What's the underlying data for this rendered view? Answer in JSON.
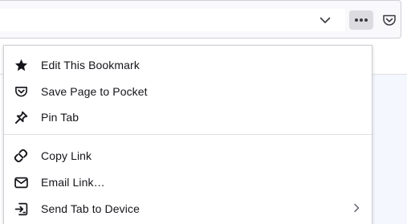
{
  "toolbar": {
    "dropmarker_icon": "chevron-down-icon",
    "page_actions_icon": "more-horizontal-icon",
    "pocket_icon": "pocket-icon"
  },
  "menu": {
    "items": [
      {
        "label": "Edit This Bookmark",
        "icon": "star-filled-icon"
      },
      {
        "label": "Save Page to Pocket",
        "icon": "pocket-icon"
      },
      {
        "label": "Pin Tab",
        "icon": "pin-icon"
      },
      {
        "label": "Copy Link",
        "icon": "link-icon"
      },
      {
        "label": "Email Link…",
        "icon": "mail-icon"
      },
      {
        "label": "Send Tab to Device",
        "icon": "send-to-device-icon",
        "submenu": true
      }
    ]
  },
  "colors": {
    "icon": "#15141a",
    "active_button_bg": "#dcdce0",
    "separator": "#e0e0e6"
  }
}
